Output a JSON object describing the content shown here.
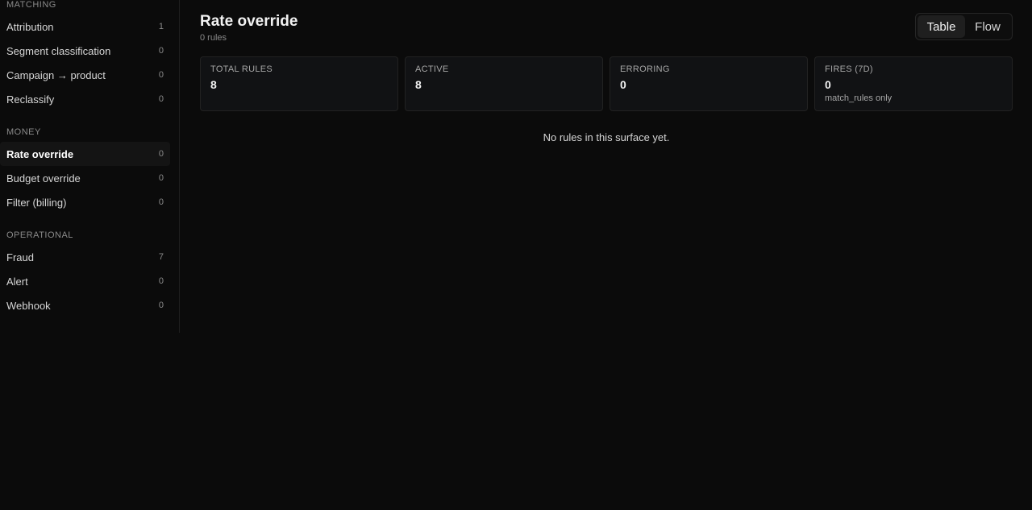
{
  "sidebar": {
    "groups": [
      {
        "label": "MATCHING",
        "items": [
          {
            "label": "Attribution",
            "count": "1"
          },
          {
            "label": "Segment classification",
            "count": "0"
          },
          {
            "label": "Campaign → product",
            "count": "0"
          },
          {
            "label": "Reclassify",
            "count": "0"
          }
        ]
      },
      {
        "label": "MONEY",
        "items": [
          {
            "label": "Rate override",
            "count": "0",
            "active": true
          },
          {
            "label": "Budget override",
            "count": "0"
          },
          {
            "label": "Filter (billing)",
            "count": "0"
          }
        ]
      },
      {
        "label": "OPERATIONAL",
        "items": [
          {
            "label": "Fraud",
            "count": "7"
          },
          {
            "label": "Alert",
            "count": "0"
          },
          {
            "label": "Webhook",
            "count": "0"
          }
        ]
      }
    ]
  },
  "header": {
    "title": "Rate override",
    "subtitle": "0 rules"
  },
  "view_toggle": {
    "table_label": "Table",
    "flow_label": "Flow",
    "selected": "Table"
  },
  "stats": [
    {
      "label": "TOTAL RULES",
      "value": "8"
    },
    {
      "label": "ACTIVE",
      "value": "8"
    },
    {
      "label": "ERRORING",
      "value": "0"
    },
    {
      "label": "FIRES (7D)",
      "value": "0",
      "sub": "match_rules only"
    }
  ],
  "empty_state": "No rules in this surface yet."
}
